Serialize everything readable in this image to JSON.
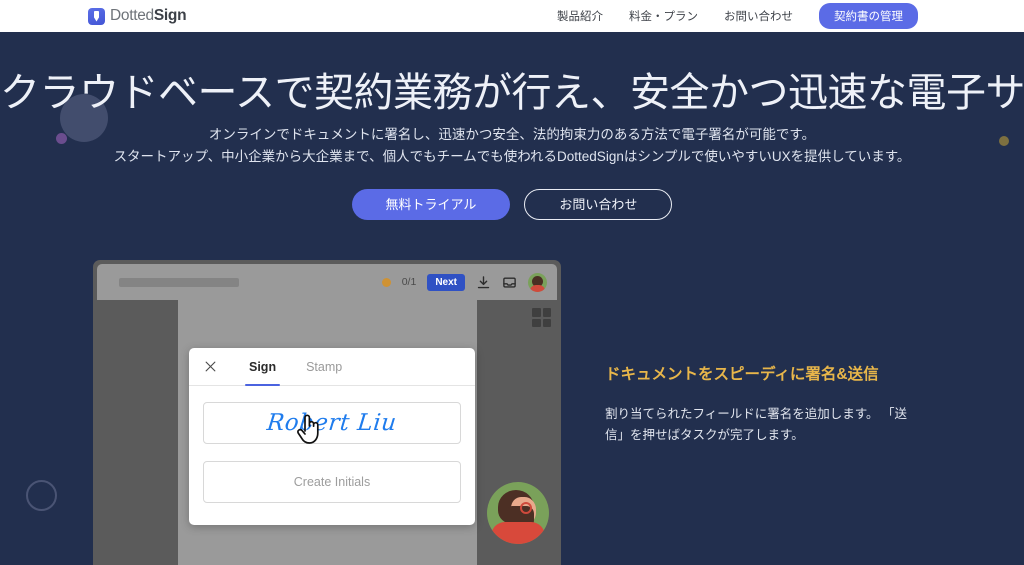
{
  "header": {
    "logo": {
      "name": "DottedSign",
      "prefix": "Dotted",
      "suffix": "Sign",
      "icon": "dottedsign-logo-icon"
    },
    "nav": [
      {
        "label": "製品紹介"
      },
      {
        "label": "料金・プラン"
      },
      {
        "label": "お問い合わせ"
      }
    ],
    "cta": {
      "label": "契約書の管理"
    }
  },
  "hero": {
    "headline": "クラウドベースで契約業務が行え、安全かつ迅速な電子サインサービス",
    "subtitle_line1": "オンラインでドキュメントに署名し、迅速かつ安全、法的拘束力のある方法で電子署名が可能です。",
    "subtitle_line2": "スタートアップ、中小企業から大企業まで、個人でもチームでも使われるDottedSignはシンプルで使いやすいUXを提供しています。",
    "primary_button": "無料トライアル",
    "secondary_button": "お問い合わせ"
  },
  "mockup": {
    "toolbar": {
      "progress_count": "0/1",
      "next_label": "Next",
      "download_icon": "download-icon",
      "inbox_icon": "inbox-icon",
      "avatar_icon": "user-avatar-icon",
      "status_dot": "progress-dot-icon"
    },
    "grid_icon": "grid-view-icon",
    "dialog": {
      "close_icon": "close-icon",
      "tabs": [
        {
          "label": "Sign",
          "active": true
        },
        {
          "label": "Stamp",
          "active": false
        }
      ],
      "signature_value": "Robert Liu",
      "initials_label": "Create Initials",
      "cursor_icon": "hand-cursor-icon"
    }
  },
  "feature": {
    "title": "ドキュメントをスピーディに署名&送信",
    "body": "割り当てられたフィールドに署名を追加します。 「送信」を押せばタスクが完了します。"
  },
  "colors": {
    "background": "#222f4e",
    "accent_blue": "#5b6be6",
    "accent_gold": "#e8b64a",
    "signature_blue": "#1f7ced",
    "tab_underline": "#4b63e0"
  }
}
